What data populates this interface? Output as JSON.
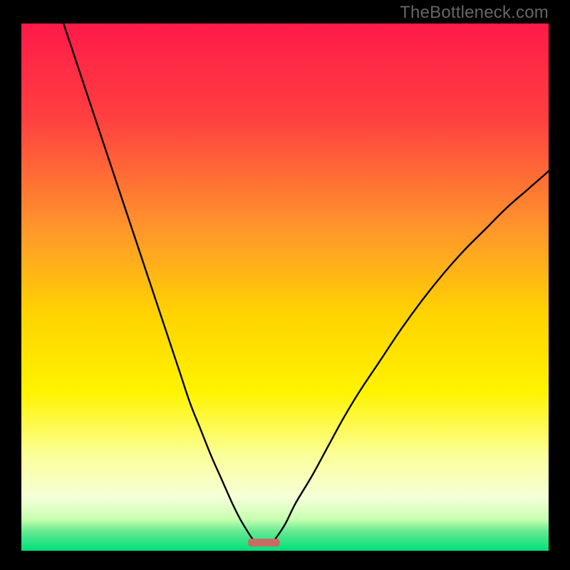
{
  "watermark": "TheBottleneck.com",
  "chart_data": {
    "type": "line",
    "title": "",
    "xlabel": "",
    "ylabel": "",
    "xlim": [
      0,
      100
    ],
    "ylim": [
      0,
      100
    ],
    "gradient_stops": [
      {
        "offset": 0.0,
        "color": "#ff1a49"
      },
      {
        "offset": 0.18,
        "color": "#ff4040"
      },
      {
        "offset": 0.4,
        "color": "#ff9a2a"
      },
      {
        "offset": 0.55,
        "color": "#ffd300"
      },
      {
        "offset": 0.7,
        "color": "#fff400"
      },
      {
        "offset": 0.82,
        "color": "#fbff9a"
      },
      {
        "offset": 0.9,
        "color": "#f5ffd8"
      },
      {
        "offset": 0.94,
        "color": "#c7ffb0"
      },
      {
        "offset": 0.965,
        "color": "#5fe890"
      },
      {
        "offset": 1.0,
        "color": "#00e07a"
      }
    ],
    "series": [
      {
        "name": "left-branch",
        "x": [
          8,
          10,
          12,
          14,
          16,
          18,
          20,
          22,
          24,
          26,
          28,
          30,
          32,
          34,
          36,
          38,
          40,
          41.5,
          43,
          44
        ],
        "y": [
          100,
          94,
          88,
          82,
          76,
          70,
          64,
          58,
          52,
          46,
          40,
          34,
          28,
          23,
          18,
          13.5,
          9,
          6,
          3.5,
          2
        ]
      },
      {
        "name": "right-branch",
        "x": [
          48,
          50,
          52,
          55,
          58,
          61,
          64,
          68,
          72,
          76,
          80,
          84,
          88,
          92,
          96,
          100
        ],
        "y": [
          2,
          5,
          9,
          14,
          19.5,
          25,
          30,
          36,
          42,
          47.5,
          52.5,
          57,
          61,
          65,
          68.5,
          72
        ]
      }
    ],
    "marker": {
      "name": "bottleneck-marker",
      "x_center": 46,
      "width": 6,
      "y": 1.6,
      "color": "#c96b65"
    }
  }
}
